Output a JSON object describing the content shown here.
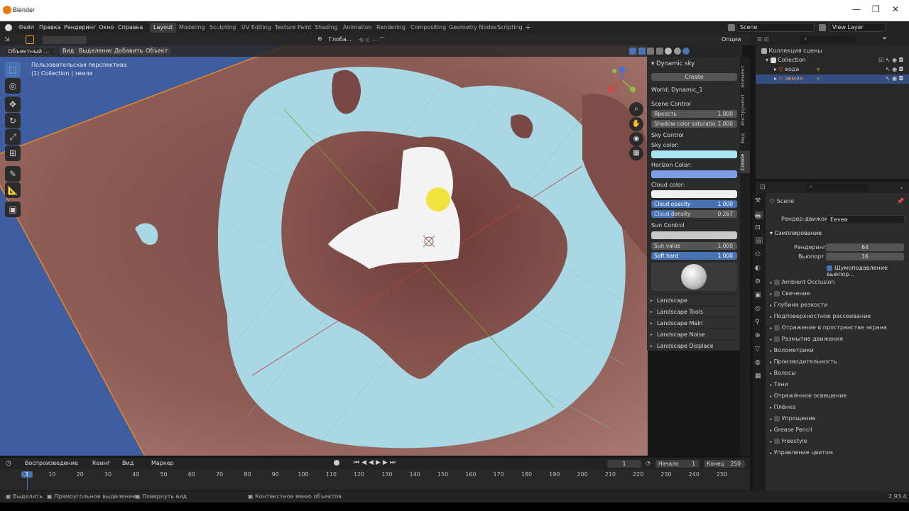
{
  "window": {
    "app_name": "Blender",
    "version": "2.93.4"
  },
  "menu": [
    "Файл",
    "Правка",
    "Рендеринг",
    "Окно",
    "Справка"
  ],
  "workspaces": [
    "Layout",
    "Modeling",
    "Sculpting",
    "UV Editing",
    "Texture Paint",
    "Shading",
    "Animation",
    "Rendering",
    "Compositing",
    "Geometry Nodes",
    "Scripting"
  ],
  "active_workspace": "Layout",
  "scene_name": "Scene",
  "view_layer": "View Layer",
  "viewport": {
    "mode": "Объектный ...",
    "menu": [
      "Вид",
      "Выделение",
      "Добавить",
      "Объект"
    ],
    "transform_orientation": "Глоба...",
    "options": "Опции",
    "overlay_line1": "Пользовательская перспектива",
    "overlay_line2": "(1) Collection | земля"
  },
  "n_panel": {
    "title": "Dynamic sky",
    "create_btn": "Create",
    "world": "World: Dynamic_1",
    "scene_control": "Scene Control",
    "brightness_label": "Яркость",
    "brightness": "1.000",
    "shadow_label": "Shadow color saturatio",
    "shadow": "1.000",
    "sky_control": "Sky Control",
    "sky_color_label": "Sky color:",
    "sky_color": "#a8e6f4",
    "horizon_label": "Horizon Color:",
    "horizon_color": "#7f9ce6",
    "cloud_color_label": "Cloud color:",
    "cloud_color": "#f0f0f0",
    "cloud_opacity_label": "Cloud opacity",
    "cloud_opacity": "1.000",
    "cloud_density_label": "Cloud density",
    "cloud_density": "0.267",
    "sun_control": "Sun Control",
    "sun_value_label": "Sun value",
    "sun_value": "1.000",
    "soft_hard_label": "Soft hard",
    "soft_hard": "1.000",
    "subpanels": [
      "Landscape",
      "Landscape Tools",
      "Landscape Main",
      "Landscape Noise",
      "Landscape Displace"
    ],
    "tabs": [
      "Элемент",
      "Инструмент",
      "Вид",
      "Create"
    ]
  },
  "outliner": {
    "root": "Коллекция сцены",
    "collection": "Collection",
    "items": [
      "вода",
      "земля"
    ]
  },
  "properties": {
    "scene_label": "Scene",
    "render_engine_label": "Рендер-движок",
    "render_engine": "Eevee",
    "sampling": "Сэмплирование",
    "render_label": "Рендеринг",
    "render_samples": "64",
    "viewport_label": "Вьюпорт",
    "viewport_samples": "16",
    "denoise": "Шумоподавление вьюпор...",
    "sections": [
      {
        "label": "Ambient Occlusion",
        "cb": true
      },
      {
        "label": "Свечение",
        "cb": true
      },
      {
        "label": "Глубина резкости",
        "cb": false
      },
      {
        "label": "Подповерхностное рассеивание",
        "cb": false
      },
      {
        "label": "Отражение в пространстве экрана",
        "cb": true
      },
      {
        "label": "Размытие движения",
        "cb": true
      },
      {
        "label": "Волометрики",
        "cb": false
      },
      {
        "label": "Производительность",
        "cb": false
      },
      {
        "label": "Волосы",
        "cb": false
      },
      {
        "label": "Тени",
        "cb": false
      },
      {
        "label": "Отражённое освещение",
        "cb": false
      },
      {
        "label": "Плёнка",
        "cb": false
      },
      {
        "label": "Упрощение",
        "cb": true
      },
      {
        "label": "Grease Pencil",
        "cb": false
      },
      {
        "label": "Freestyle",
        "cb": true
      },
      {
        "label": "Управление цветом",
        "cb": false
      }
    ]
  },
  "timeline": {
    "menu": [
      "Воспроизведение",
      "Кеинг",
      "Вид",
      "Маркер"
    ],
    "current_frame": "1",
    "start_label": "Начало",
    "start": "1",
    "end_label": "Конец",
    "end": "250",
    "ticks": [
      "1",
      "10",
      "20",
      "30",
      "40",
      "50",
      "60",
      "70",
      "80",
      "90",
      "100",
      "110",
      "120",
      "130",
      "140",
      "150",
      "160",
      "170",
      "180",
      "190",
      "200",
      "210",
      "220",
      "230",
      "240",
      "250"
    ]
  },
  "statusbar": {
    "select": "Выделить",
    "box_select": "Прямоугольное выделение",
    "rotate": "Повернуть вид",
    "context": "Контекстное меню объектов"
  }
}
